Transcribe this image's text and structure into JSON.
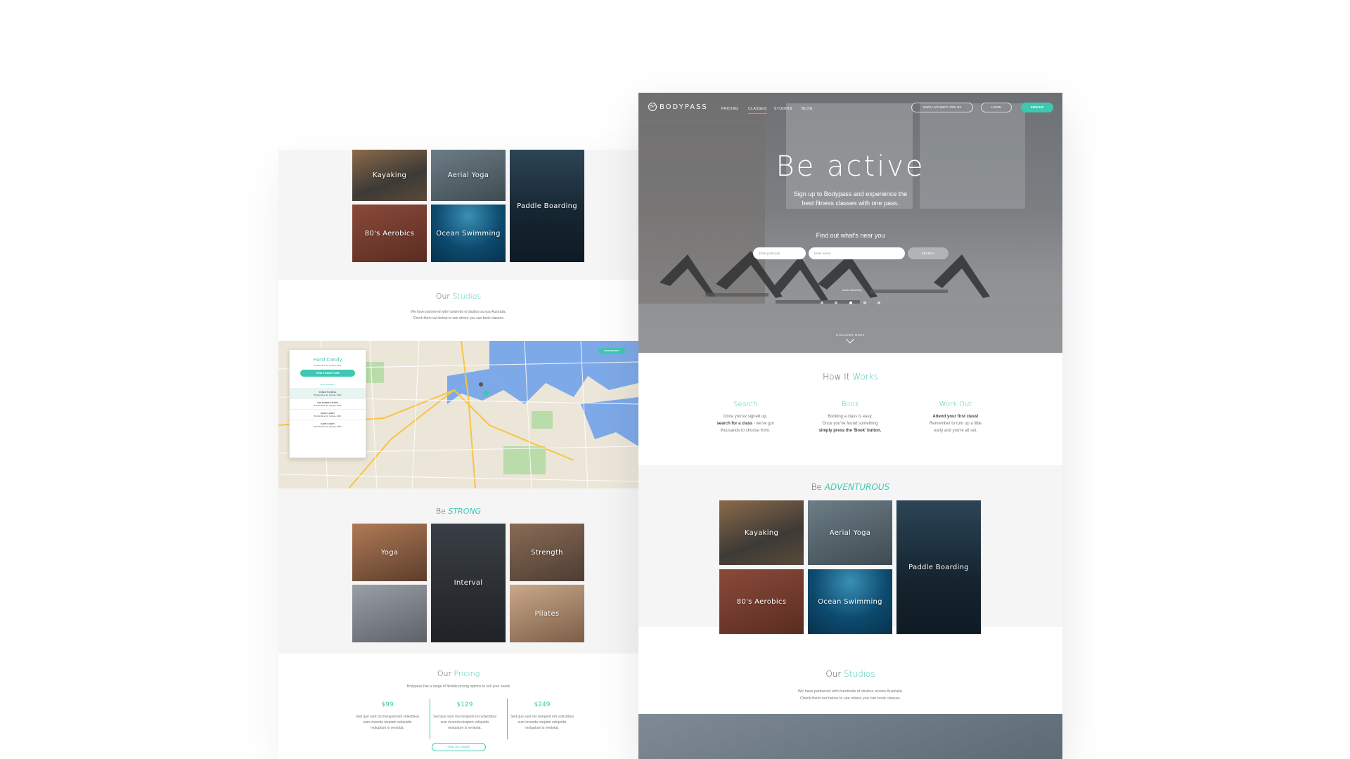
{
  "colors": {
    "accent": "#3dc9b1"
  },
  "left": {
    "top_tiles": [
      "Kayaking",
      "Aerial Yoga",
      "Paddle Boarding",
      "80's Aerobics",
      "Ocean Swimming"
    ],
    "studios": {
      "title_a": "Our",
      "title_b": "Studios",
      "text1": "We have partnered with hundreds of studios across Australia.",
      "text2": "Check them out below to see where you can book classes."
    },
    "map": {
      "panel_title": "Hard Candy",
      "panel_address": "844 Erskine St, Sydney 2000",
      "panel_button": "VIEW STUDIO PAGE",
      "also_nearby": "ALSO NEARBY:",
      "nearby": [
        {
          "name": "FUSED TO MOVE",
          "addr": "844 Erskine St, Sydney 2000"
        },
        {
          "name": "THE BARRE STUDIO",
          "addr": "844 Erskine St, Sydney 2000"
        },
        {
          "name": "HARD CANDY",
          "addr": "844 Erskine St, Sydney 2000"
        },
        {
          "name": "HARD CANDY",
          "addr": "844 Erskine St, Sydney 2000"
        }
      ],
      "map_button": "VIEW NEARBY"
    },
    "strong": {
      "title_a": "Be",
      "title_b": "STRONG",
      "tiles": [
        "Yoga",
        "Interval",
        "Strength",
        "Pilates"
      ]
    },
    "pricing": {
      "title_a": "Our",
      "title_b": "Pricing",
      "text": "Bodypass has a range of flexible pricing options to suit your needs",
      "plans": [
        {
          "price": "$99",
          "desc": "Sed que sunt mo beraped ent volectibea sum invenda nisqiam veliquidis molupture is ventotat."
        },
        {
          "price": "$129",
          "desc": "Sed que sunt mo beraped ent volectibea sum invenda nisqiam veliquidis molupture is ventotat."
        },
        {
          "price": "$249",
          "desc": "Sed que sunt mo beraped ent volectibea sum invenda nisqiam veliquidis molupture is ventotat."
        }
      ],
      "button": "FIND OUT MORE"
    }
  },
  "right": {
    "brand": "BODYPASS",
    "nav": [
      "PRICING",
      "CLASSES",
      "STUDIOS",
      "BLOG"
    ],
    "nav_active": "CLASSES",
    "own_studio": "OWN A STUDIO? JOIN US",
    "login": "LOGIN",
    "signup": "SIGN UP",
    "hero": {
      "title": "Be active",
      "sub1": "Sign up to Bodypass and experience the",
      "sub2": "best fitness classes with one pass.",
      "find": "Find out what's near you",
      "postcode_placeholder": "Enter postcode",
      "email_placeholder": "Enter email",
      "search": "SEARCH",
      "caption": "Ocean Swimming",
      "discover": "DISCOVER MORE"
    },
    "how": {
      "title_a": "How It",
      "title_b": "Works",
      "cols": [
        {
          "title": "Search",
          "l1": "Once you've signed up,",
          "l2b": "search for a class",
          "l2": " - we've got",
          "l3": "thousands to choose from."
        },
        {
          "title": "Book",
          "l1": "Booking a class is easy.",
          "l2b": "",
          "l2": "Once you've found something",
          "l3": "simply press the 'Book' button."
        },
        {
          "title": "Work Out",
          "l1": "Attend your first class!",
          "l2b": "",
          "l2": "Remember to turn up a little",
          "l3": "early and you're all set."
        }
      ]
    },
    "adventurous": {
      "title_a": "Be",
      "title_b": "ADVENTUROUS",
      "tiles": [
        "Kayaking",
        "Aerial Yoga",
        "Paddle Boarding",
        "80's Aerobics",
        "Ocean Swimming"
      ]
    },
    "studios": {
      "title_a": "Our",
      "title_b": "Studios",
      "text1": "We have partnered with hundreds of studios across Australia.",
      "text2": "Check them out below to see where you can book classes."
    }
  }
}
